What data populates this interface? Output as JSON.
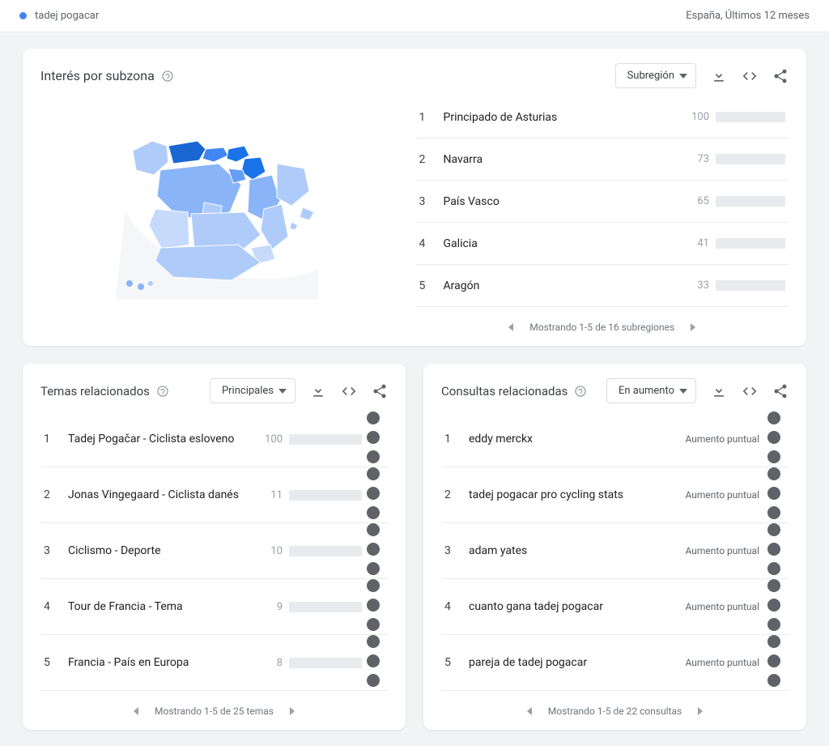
{
  "colors": {
    "accent": "#4285f4"
  },
  "topbar": {
    "term": "tadej pogacar",
    "scope": "España, Últimos 12 meses"
  },
  "subzone": {
    "title": "Interés por subzona",
    "dropdown": "Subregión",
    "regions": [
      {
        "rank": 1,
        "name": "Principado de Asturias",
        "value": 100
      },
      {
        "rank": 2,
        "name": "Navarra",
        "value": 73
      },
      {
        "rank": 3,
        "name": "País Vasco",
        "value": 65
      },
      {
        "rank": 4,
        "name": "Galicia",
        "value": 41
      },
      {
        "rank": 5,
        "name": "Aragón",
        "value": 33
      }
    ],
    "pager": "Mostrando 1-5 de 16 subregiones"
  },
  "topics": {
    "title": "Temas relacionados",
    "dropdown": "Principales",
    "items": [
      {
        "rank": 1,
        "name": "Tadej Pogačar - Ciclista esloveno",
        "value": 100
      },
      {
        "rank": 2,
        "name": "Jonas Vingegaard - Ciclista danés",
        "value": 11
      },
      {
        "rank": 3,
        "name": "Ciclismo - Deporte",
        "value": 10
      },
      {
        "rank": 4,
        "name": "Tour de Francia - Tema",
        "value": 9
      },
      {
        "rank": 5,
        "name": "Francia - País en Europa",
        "value": 8
      }
    ],
    "pager": "Mostrando 1-5 de 25 temas"
  },
  "queries": {
    "title": "Consultas relacionadas",
    "dropdown": "En aumento",
    "rising_label": "Aumento puntual",
    "items": [
      {
        "rank": 1,
        "name": "eddy merckx"
      },
      {
        "rank": 2,
        "name": "tadej pogacar pro cycling stats"
      },
      {
        "rank": 3,
        "name": "adam yates"
      },
      {
        "rank": 4,
        "name": "cuanto gana tadej pogacar"
      },
      {
        "rank": 5,
        "name": "pareja de tadej pogacar"
      }
    ],
    "pager": "Mostrando 1-5 de 22 consultas"
  },
  "chart_data": [
    {
      "type": "bar",
      "title": "Interés por subzona",
      "categories": [
        "Principado de Asturias",
        "Navarra",
        "País Vasco",
        "Galicia",
        "Aragón"
      ],
      "values": [
        100,
        73,
        65,
        41,
        33
      ],
      "ylim": [
        0,
        100
      ],
      "xlabel": "",
      "ylabel": ""
    },
    {
      "type": "bar",
      "title": "Temas relacionados (Principales)",
      "categories": [
        "Tadej Pogačar - Ciclista esloveno",
        "Jonas Vingegaard - Ciclista danés",
        "Ciclismo - Deporte",
        "Tour de Francia - Tema",
        "Francia - País en Europa"
      ],
      "values": [
        100,
        11,
        10,
        9,
        8
      ],
      "ylim": [
        0,
        100
      ],
      "xlabel": "",
      "ylabel": ""
    }
  ]
}
